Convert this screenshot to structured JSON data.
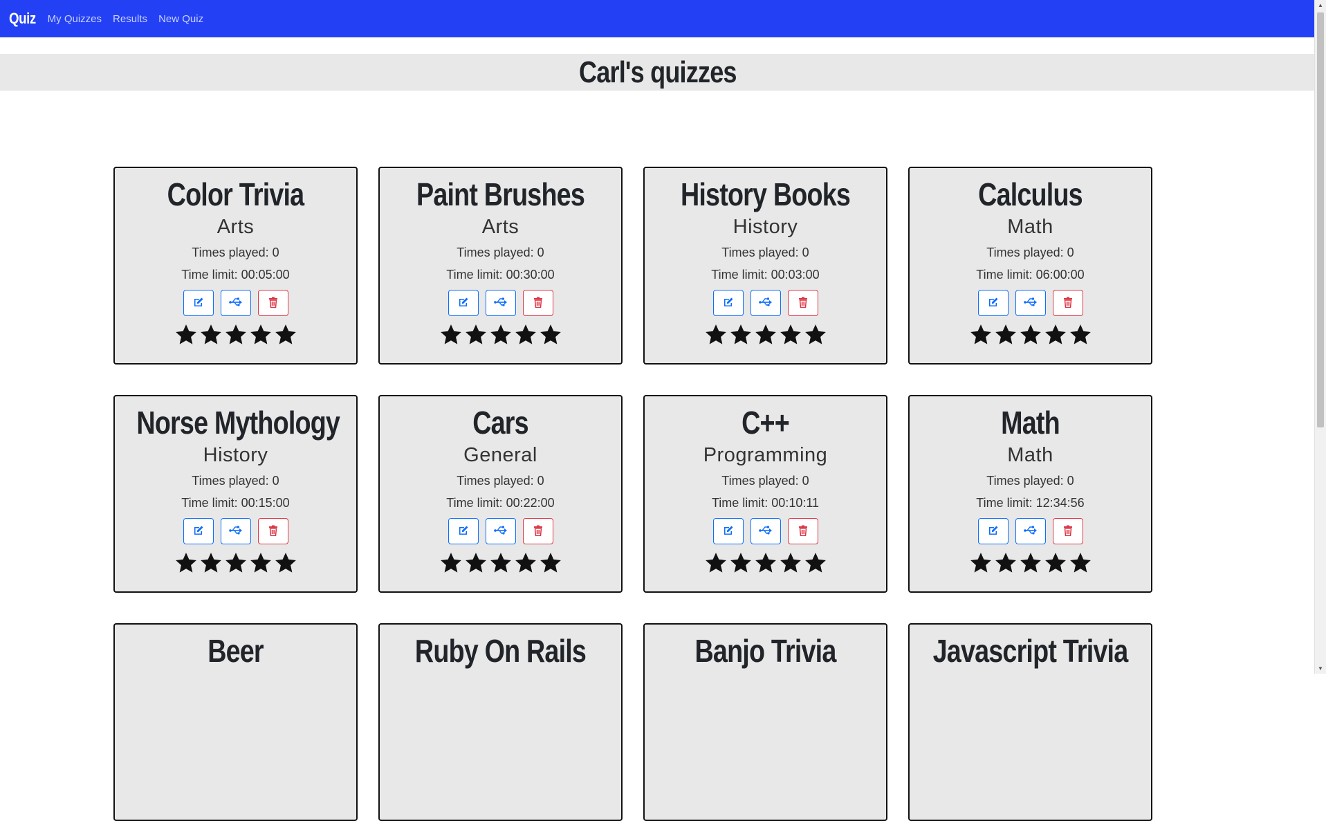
{
  "nav": {
    "brand": "Quiz",
    "links": [
      "My Quizzes",
      "Results",
      "New Quiz"
    ]
  },
  "page": {
    "title": "Carl's quizzes"
  },
  "colors": {
    "navbar": "#2440f5",
    "primary": "#0d6efd",
    "danger": "#dc3545"
  },
  "icons": {
    "edit": "edit-icon",
    "share": "share-icon",
    "delete": "trash-icon",
    "rating": "star-icon"
  },
  "quizzes": [
    {
      "title": "Color Trivia",
      "category": "Arts",
      "times_played": "Times played: 0",
      "time_limit": "Time limit: 00:05:00",
      "rating": 5
    },
    {
      "title": "Paint Brushes",
      "category": "Arts",
      "times_played": "Times played: 0",
      "time_limit": "Time limit: 00:30:00",
      "rating": 5
    },
    {
      "title": "History Books",
      "category": "History",
      "times_played": "Times played: 0",
      "time_limit": "Time limit: 00:03:00",
      "rating": 5
    },
    {
      "title": "Calculus",
      "category": "Math",
      "times_played": "Times played: 0",
      "time_limit": "Time limit: 06:00:00",
      "rating": 5
    },
    {
      "title": "Norse Mythology",
      "category": "History",
      "times_played": "Times played: 0",
      "time_limit": "Time limit: 00:15:00",
      "rating": 5
    },
    {
      "title": "Cars",
      "category": "General",
      "times_played": "Times played: 0",
      "time_limit": "Time limit: 00:22:00",
      "rating": 5
    },
    {
      "title": "C++",
      "category": "Programming",
      "times_played": "Times played: 0",
      "time_limit": "Time limit: 00:10:11",
      "rating": 5
    },
    {
      "title": "Math",
      "category": "Math",
      "times_played": "Times played: 0",
      "time_limit": "Time limit: 12:34:56",
      "rating": 5
    },
    {
      "title": "Beer"
    },
    {
      "title": "Ruby On Rails"
    },
    {
      "title": "Banjo Trivia"
    },
    {
      "title": "Javascript Trivia"
    }
  ]
}
